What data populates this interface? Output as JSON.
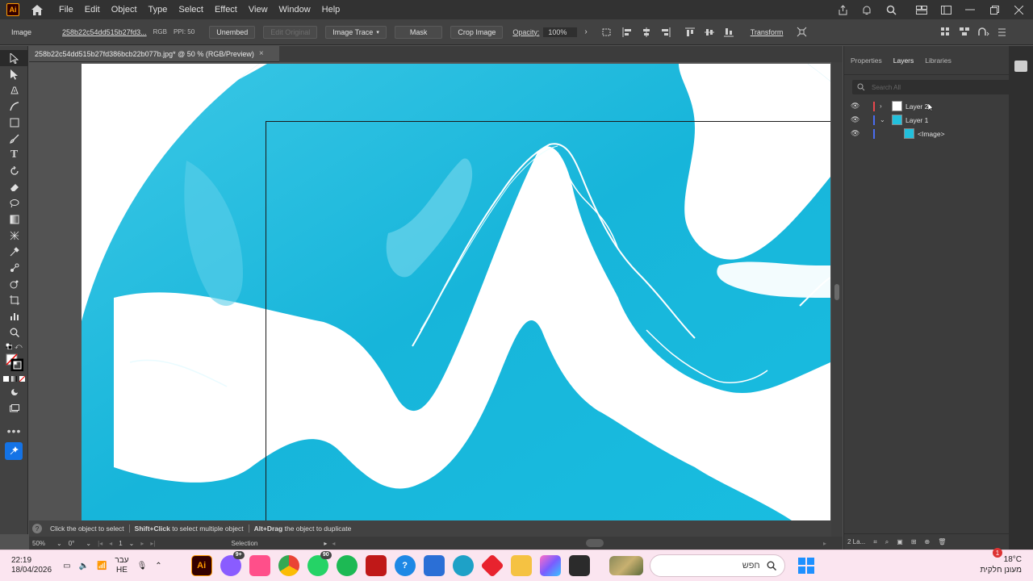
{
  "menubar": {
    "logo": "Ai",
    "items": [
      "File",
      "Edit",
      "Object",
      "Type",
      "Select",
      "Effect",
      "View",
      "Window",
      "Help"
    ]
  },
  "control": {
    "kind": "Image",
    "filename": "258b22c54dd515b27fd3...",
    "color_mode": "RGB",
    "ppi": "PPI: 50",
    "unembed": "Unembed",
    "edit_original": "Edit Original",
    "image_trace": "Image Trace",
    "mask": "Mask",
    "crop_image": "Crop Image",
    "opacity_label": "Opacity:",
    "opacity_value": "100%",
    "transform": "Transform"
  },
  "document": {
    "tab_title": "258b22c54dd515b27fd386bcb22b077b.jpg* @ 50 % (RGB/Preview)",
    "close": "×"
  },
  "infobar": {
    "help": "?",
    "tip1": "Click the object to select",
    "tip2_key": "Shift+Click",
    "tip2": "to select multiple object",
    "tip3_key": "Alt+Drag",
    "tip3": "the object to duplicate"
  },
  "statusbar": {
    "zoom": "50%",
    "rotation": "0°",
    "artboard": "1",
    "mode": "Selection"
  },
  "panel": {
    "tabs": [
      "Properties",
      "Layers",
      "Libraries"
    ],
    "active_tab": "Layers",
    "search_placeholder": "Search All",
    "layers": [
      {
        "name": "Layer 2",
        "color": "#e8484d",
        "thumb": "#ffffff",
        "expanded": false
      },
      {
        "name": "Layer 1",
        "color": "#4a6df0",
        "thumb": "#22c0dc",
        "expanded": true
      },
      {
        "name": "<Image>",
        "color": "#4a6df0",
        "thumb": "#22c0dc",
        "child": true
      }
    ],
    "footer": "2 La..."
  },
  "taskbar": {
    "time": "22:19",
    "date": "18/04/2026",
    "lang": "עבר",
    "lang_code": "HE",
    "search_placeholder": "חפש",
    "weather_temp": "18°C",
    "weather_desc": "מעונן חלקית",
    "weather_badge": "1",
    "badge_messenger": "9+",
    "badge_whatsapp": "90"
  },
  "colors": {
    "accent": "#1473e6",
    "paint": "#22bfdf"
  }
}
